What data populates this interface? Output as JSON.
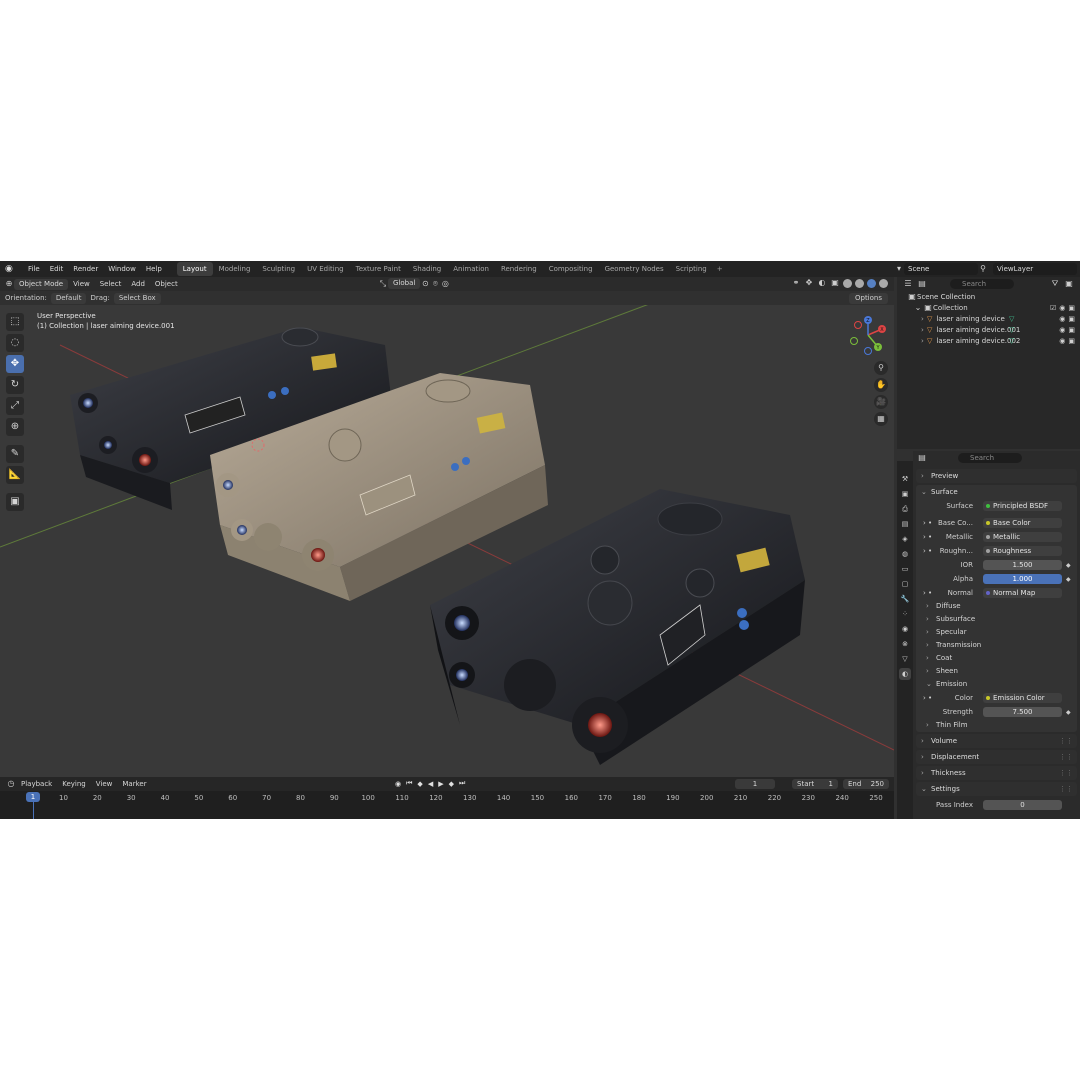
{
  "topbar": {
    "menus": [
      "File",
      "Edit",
      "Render",
      "Window",
      "Help"
    ],
    "workspaces": [
      "Layout",
      "Modeling",
      "Sculpting",
      "UV Editing",
      "Texture Paint",
      "Shading",
      "Animation",
      "Rendering",
      "Compositing",
      "Geometry Nodes",
      "Scripting"
    ],
    "active_workspace": "Layout",
    "scene": "Scene",
    "view_layer": "ViewLayer"
  },
  "viewport_header": {
    "mode": "Object Mode",
    "menus": [
      "View",
      "Select",
      "Add",
      "Object"
    ],
    "transform_orientation": "Global"
  },
  "viewport_sub": {
    "orientation_label": "Orientation:",
    "orientation_value": "Default",
    "drag_label": "Drag:",
    "drag_value": "Select Box",
    "options": "Options"
  },
  "viewport_info": {
    "line1": "User Perspective",
    "line2": "(1) Collection | laser aiming device.001"
  },
  "gizmo": {
    "x": "X",
    "y": "Y",
    "z": "Z"
  },
  "timeline": {
    "menus": [
      "Playback",
      "Keying",
      "View",
      "Marker"
    ],
    "current_frame": "1",
    "start_label": "Start",
    "start_value": "1",
    "end_label": "End",
    "end_value": "250",
    "ticks": [
      "1",
      "10",
      "20",
      "30",
      "40",
      "50",
      "60",
      "70",
      "80",
      "90",
      "100",
      "110",
      "120",
      "130",
      "140",
      "150",
      "160",
      "170",
      "180",
      "190",
      "200",
      "210",
      "220",
      "230",
      "240",
      "250"
    ]
  },
  "outliner": {
    "search_placeholder": "Search",
    "scene_collection": "Scene Collection",
    "collection": "Collection",
    "objects": [
      "laser aiming device",
      "laser aiming device.001",
      "laser aiming device.002"
    ]
  },
  "properties": {
    "search_placeholder": "Search",
    "preview": "Preview",
    "surface_panel": "Surface",
    "surface_label": "Surface",
    "surface_value": "Principled BSDF",
    "base_color_label": "Base Co...",
    "base_color_value": "Base Color",
    "metallic_label": "Metallic",
    "metallic_value": "Metallic",
    "roughness_label": "Roughn...",
    "roughness_value": "Roughness",
    "ior_label": "IOR",
    "ior_value": "1.500",
    "alpha_label": "Alpha",
    "alpha_value": "1.000",
    "normal_label": "Normal",
    "normal_value": "Normal Map",
    "subpanels": [
      "Diffuse",
      "Subsurface",
      "Specular",
      "Transmission",
      "Coat",
      "Sheen"
    ],
    "emission": "Emission",
    "emission_color_label": "Color",
    "emission_color_value": "Emission Color",
    "strength_label": "Strength",
    "strength_value": "7.500",
    "thin_film": "Thin Film",
    "volume": "Volume",
    "displacement": "Displacement",
    "thickness": "Thickness",
    "settings": "Settings",
    "pass_index_label": "Pass Index",
    "pass_index_value": "0"
  },
  "colors": {
    "accent": "#4a72b8",
    "socket_yellow": "#c7c729",
    "socket_gray": "#a1a1a1",
    "socket_purple": "#6363c7",
    "object_orange": "#e69a4b",
    "mesh_green": "#3fbf8f"
  }
}
